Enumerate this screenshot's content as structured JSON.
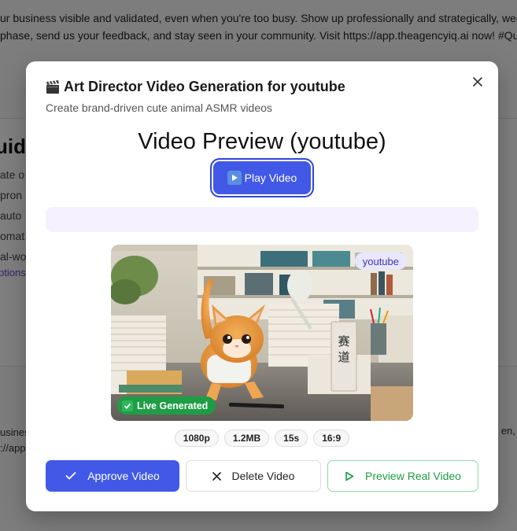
{
  "background": {
    "top_lines": [
      "ur business visible and validated, even when you're too busy. Show up professionally and strategically, week in, week",
      "phase, send us your feedback, and stay seen in your community. Visit https://app.theagencyiq.ai now! #QueenslandB"
    ],
    "heading": "uid",
    "lines": [
      "ate o",
      "pron",
      "auto",
      "omat",
      "al-wo"
    ],
    "link": "ptions",
    "bottom_lines": [
      "usines",
      "://app"
    ],
    "bottom_right": "en, s"
  },
  "modal": {
    "title": "Art Director Video Generation for youtube",
    "subtitle": "Create brand-driven cute animal ASMR videos",
    "close_icon": "close-icon",
    "preview_heading": "Video Preview (youtube)",
    "play_button": "Play Video",
    "video": {
      "platform_badge": "youtube",
      "live_badge": "Live Generated",
      "sign_text": [
        "赛",
        "道"
      ]
    },
    "specs": [
      "1080p",
      "1.2MB",
      "15s",
      "16:9"
    ],
    "actions": {
      "approve": "Approve Video",
      "delete": "Delete Video",
      "preview": "Preview Real Video"
    }
  },
  "colors": {
    "primary": "#4159e6",
    "success": "#1f9d45",
    "badge_bg": "#e9e6ff",
    "status_bar": "#f6f1ff"
  }
}
